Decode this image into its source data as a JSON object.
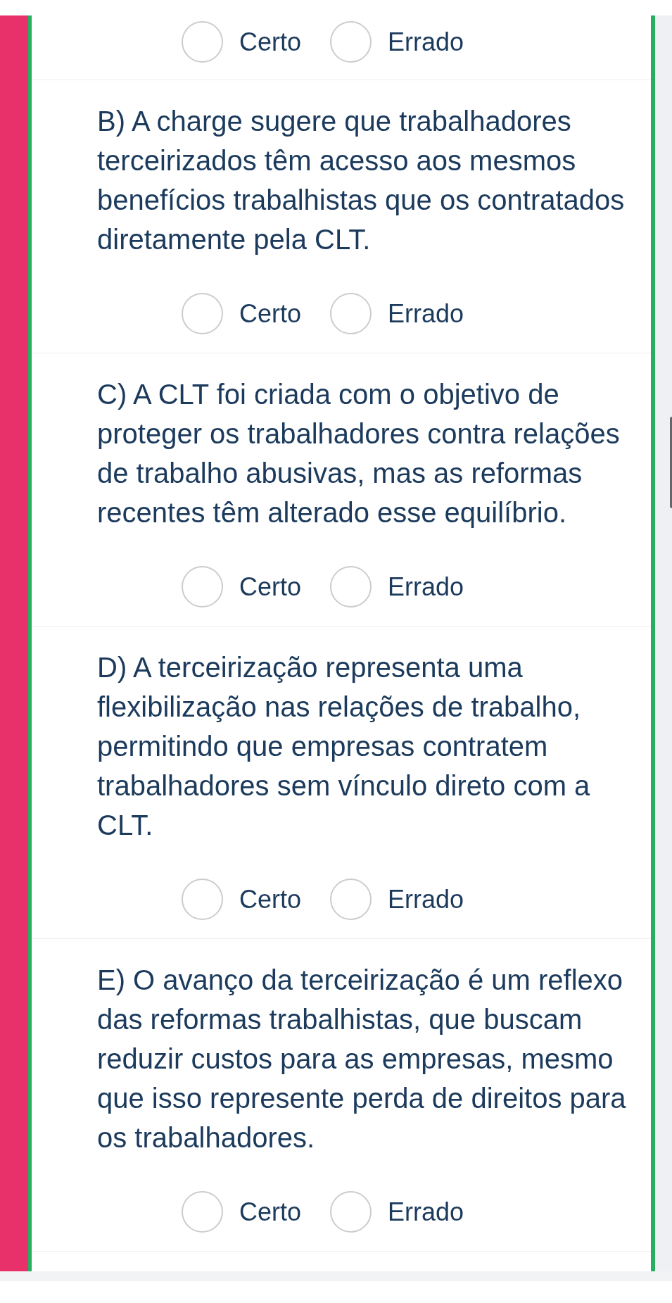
{
  "top_options": [
    {
      "label": "Certo",
      "selected": false
    },
    {
      "label": "Errado",
      "selected": false
    }
  ],
  "statements": [
    {
      "text": "B) A charge sugere que trabalhadores terceirizados têm acesso aos mesmos benefícios trabalhistas que os contratados diretamente pela CLT.",
      "options": [
        {
          "label": "Certo",
          "selected": false
        },
        {
          "label": "Errado",
          "selected": false
        }
      ]
    },
    {
      "text": "C) A CLT foi criada com o objetivo de proteger os trabalhadores contra relações de trabalho abusivas, mas as reformas recentes têm alterado esse equilíbrio.",
      "options": [
        {
          "label": "Certo",
          "selected": false
        },
        {
          "label": "Errado",
          "selected": false
        }
      ]
    },
    {
      "text": "D) A terceirização representa uma flexibilização nas relações de trabalho, permitindo que empresas contratem trabalhadores sem vínculo direto com a CLT.",
      "options": [
        {
          "label": "Certo",
          "selected": false
        },
        {
          "label": "Errado",
          "selected": false
        }
      ]
    },
    {
      "text": "E) O avanço da terceirização é um reflexo das reformas trabalhistas, que buscam reduzir custos para as empresas, mesmo que isso represente perda de direitos para os trabalhadores.",
      "options": [
        {
          "label": "Certo",
          "selected": false
        },
        {
          "label": "Errado",
          "selected": false
        }
      ]
    }
  ]
}
